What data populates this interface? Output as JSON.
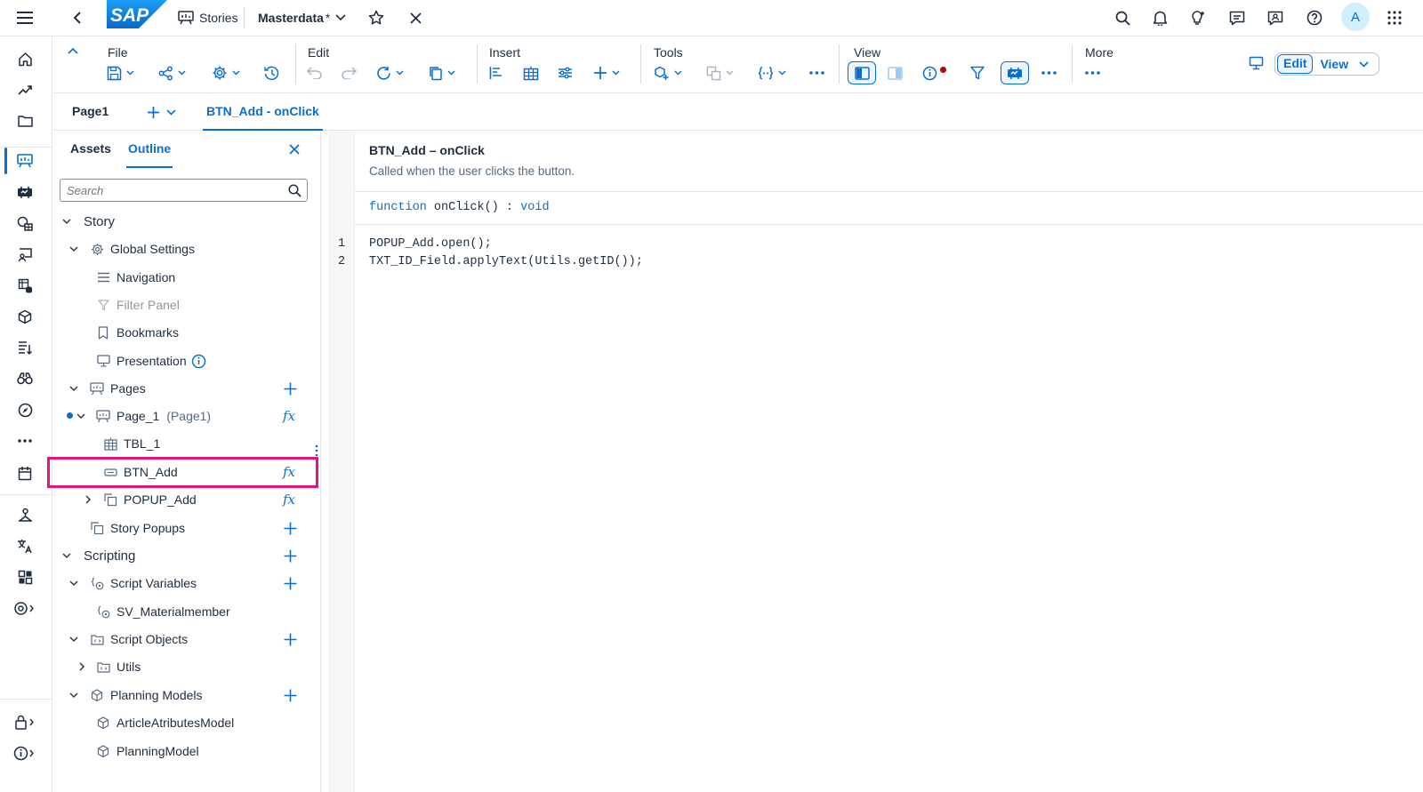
{
  "shell": {
    "stories_label": "Stories",
    "story_name": "Masterdata",
    "unsaved_mark": "*",
    "avatar_initial": "A",
    "logo_text": "SAP"
  },
  "toolbar": {
    "file": "File",
    "edit": "Edit",
    "insert": "Insert",
    "tools": "Tools",
    "view": "View",
    "more": "More",
    "edit_mode": "Edit",
    "view_mode": "View"
  },
  "tabs": {
    "page": "Page1",
    "script": "BTN_Add - onClick"
  },
  "panel": {
    "assets_tab": "Assets",
    "outline_tab": "Outline",
    "search_placeholder": "Search",
    "tree": {
      "story": "Story",
      "global_settings": "Global Settings",
      "navigation": "Navigation",
      "filter_panel": "Filter Panel",
      "bookmarks": "Bookmarks",
      "presentation": "Presentation",
      "pages": "Pages",
      "page_1": "Page_1",
      "page_1_sub": "(Page1)",
      "tbl_1": "TBL_1",
      "btn_add": "BTN_Add",
      "popup_add": "POPUP_Add",
      "story_popups": "Story Popups",
      "scripting": "Scripting",
      "script_variables": "Script Variables",
      "sv_materialmember": "SV_Materialmember",
      "script_objects": "Script Objects",
      "utils": "Utils",
      "planning_models": "Planning Models",
      "article_model": "ArticleAtributesModel",
      "planning_model": "PlanningModel"
    }
  },
  "editor": {
    "title": "BTN_Add – onClick",
    "description": "Called when the user clicks the button.",
    "sig_keyword": "function",
    "sig_name": "onClick() :",
    "sig_type": "void",
    "lines": [
      {
        "num": "1",
        "code": "POPUP_Add.open();"
      },
      {
        "num": "2",
        "code": "TXT_ID_Field.applyText(Utils.getID());"
      }
    ]
  },
  "colors": {
    "accent": "#0a6ed1",
    "highlight": "#e0177a",
    "status_dot": "#bb0000"
  }
}
